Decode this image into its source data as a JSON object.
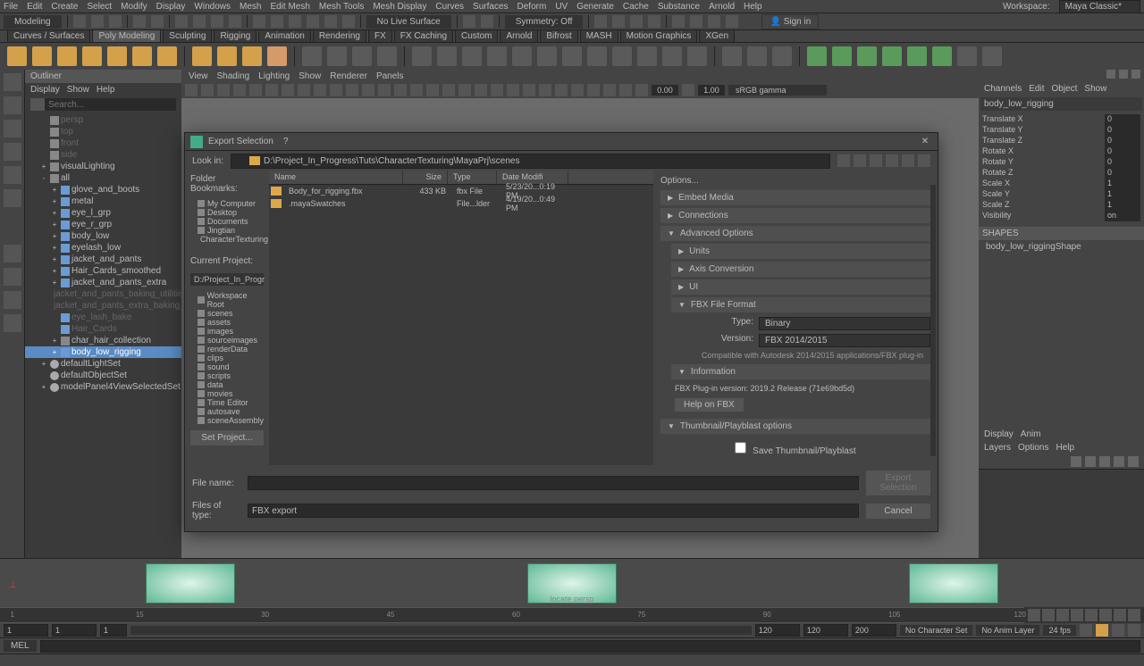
{
  "menubar": [
    "File",
    "Edit",
    "Create",
    "Select",
    "Modify",
    "Display",
    "Windows",
    "Mesh",
    "Edit Mesh",
    "Mesh Tools",
    "Mesh Display",
    "Curves",
    "Surfaces",
    "Deform",
    "UV",
    "Generate",
    "Cache",
    "Substance",
    "Arnold",
    "Help"
  ],
  "workspaceLabel": "Workspace:",
  "workspace": "Maya Classic*",
  "modelingDD": "Modeling",
  "liveSurface": "No Live Surface",
  "symmetry": "Symmetry: Off",
  "signIn": "Sign in",
  "tabs": [
    "Curves / Surfaces",
    "Poly Modeling",
    "Sculpting",
    "Rigging",
    "Animation",
    "Rendering",
    "FX",
    "FX Caching",
    "Custom",
    "Arnold",
    "Bifrost",
    "MASH",
    "Motion Graphics",
    "XGen"
  ],
  "activeTab": 1,
  "outliner": {
    "title": "Outliner",
    "menu": [
      "Display",
      "Show",
      "Help"
    ],
    "searchPH": "Search...",
    "tree": [
      {
        "ind": 1,
        "tog": "",
        "type": "grp",
        "name": "persp",
        "dim": true
      },
      {
        "ind": 1,
        "tog": "",
        "type": "grp",
        "name": "top",
        "dim": true
      },
      {
        "ind": 1,
        "tog": "",
        "type": "grp",
        "name": "front",
        "dim": true
      },
      {
        "ind": 1,
        "tog": "",
        "type": "grp",
        "name": "side",
        "dim": true
      },
      {
        "ind": 1,
        "tog": "+",
        "type": "grp",
        "name": "visualLighting"
      },
      {
        "ind": 1,
        "tog": "-",
        "type": "grp",
        "name": "all"
      },
      {
        "ind": 2,
        "tog": "+",
        "type": "mesh",
        "name": "glove_and_boots"
      },
      {
        "ind": 2,
        "tog": "+",
        "type": "mesh",
        "name": "metal"
      },
      {
        "ind": 2,
        "tog": "+",
        "type": "mesh",
        "name": "eye_l_grp"
      },
      {
        "ind": 2,
        "tog": "+",
        "type": "mesh",
        "name": "eye_r_grp"
      },
      {
        "ind": 2,
        "tog": "+",
        "type": "mesh",
        "name": "body_low"
      },
      {
        "ind": 2,
        "tog": "+",
        "type": "mesh",
        "name": "eyelash_low"
      },
      {
        "ind": 2,
        "tog": "+",
        "type": "mesh",
        "name": "jacket_and_pants"
      },
      {
        "ind": 2,
        "tog": "+",
        "type": "mesh",
        "name": "Hair_Cards_smoothed"
      },
      {
        "ind": 2,
        "tog": "+",
        "type": "mesh",
        "name": "jacket_and_pants_extra"
      },
      {
        "ind": 2,
        "tog": "",
        "type": "mesh",
        "name": "jacket_and_pants_baking_utilities",
        "dim": true
      },
      {
        "ind": 2,
        "tog": "",
        "type": "mesh",
        "name": "jacket_and_pants_extra_baking_utili",
        "dim": true
      },
      {
        "ind": 2,
        "tog": "",
        "type": "mesh",
        "name": "eye_lash_bake",
        "dim": true
      },
      {
        "ind": 2,
        "tog": "",
        "type": "mesh",
        "name": "Hair_Cards",
        "dim": true
      },
      {
        "ind": 2,
        "tog": "+",
        "type": "grp",
        "name": "char_hair_collection"
      },
      {
        "ind": 2,
        "tog": "+",
        "type": "mesh",
        "name": "body_low_rigging",
        "sel": true
      },
      {
        "ind": 1,
        "tog": "+",
        "type": "set",
        "name": "defaultLightSet"
      },
      {
        "ind": 1,
        "tog": "",
        "type": "set",
        "name": "defaultObjectSet"
      },
      {
        "ind": 1,
        "tog": "+",
        "type": "set",
        "name": "modelPanel4ViewSelectedSet"
      }
    ]
  },
  "viewport": {
    "menu": [
      "View",
      "Shading",
      "Lighting",
      "Show",
      "Renderer",
      "Panels"
    ],
    "num1": "0.00",
    "num2": "1.00",
    "gamma": "sRGB gamma",
    "perLabel": "locate   persp"
  },
  "channel": {
    "menu": [
      "Channels",
      "Edit",
      "Object",
      "Show"
    ],
    "objName": "body_low_rigging",
    "attrs": [
      {
        "n": "Translate X",
        "v": "0"
      },
      {
        "n": "Translate Y",
        "v": "0"
      },
      {
        "n": "Translate Z",
        "v": "0"
      },
      {
        "n": "Rotate X",
        "v": "0"
      },
      {
        "n": "Rotate Y",
        "v": "0"
      },
      {
        "n": "Rotate Z",
        "v": "0"
      },
      {
        "n": "Scale X",
        "v": "1"
      },
      {
        "n": "Scale Y",
        "v": "1"
      },
      {
        "n": "Scale Z",
        "v": "1"
      },
      {
        "n": "Visibility",
        "v": "on"
      }
    ],
    "shapesHdr": "SHAPES",
    "shapeName": "body_low_riggingShape"
  },
  "layers": {
    "tabs": [
      "Display",
      "Anim"
    ],
    "menu": [
      "Layers",
      "Options",
      "Help"
    ]
  },
  "timeline": {
    "ticks": [
      "1",
      "15",
      "30",
      "45",
      "60",
      "75",
      "90",
      "105",
      "120"
    ],
    "rangeStart": "1",
    "playStart": "1",
    "curFrame": "1",
    "playEnd": "120",
    "rangeEnd": "120",
    "rangeEnd2": "200",
    "charSet": "No Character Set",
    "animLayer": "No Anim Layer",
    "fps": "24 fps"
  },
  "mel": "MEL",
  "dialog": {
    "title": "Export Selection",
    "lookInLabel": "Look in:",
    "path": "D:\\Project_In_Progress\\Tuts\\CharacterTexturing\\MayaPrj\\scenes",
    "bookmarksHdr": "Folder Bookmarks:",
    "bookmarks": [
      "My Computer",
      "Desktop",
      "Documents",
      "Jingtian",
      "CharacterTexturing"
    ],
    "curProjHdr": "Current Project:",
    "curProj": "D:/Project_In_Progr",
    "wsItems": [
      "Workspace Root",
      "scenes",
      "assets",
      "images",
      "sourceimages",
      "renderData",
      "clips",
      "sound",
      "scripts",
      "data",
      "movies",
      "Time Editor",
      "autosave",
      "sceneAssembly"
    ],
    "setProject": "Set Project...",
    "cols": {
      "name": "Name",
      "size": "Size",
      "type": "Type",
      "date": "Date Modifi"
    },
    "files": [
      {
        "name": "Body_for_rigging.fbx",
        "size": "433 KB",
        "type": "fbx File",
        "date": "5/23/20...0:19 PM"
      },
      {
        "name": ".mayaSwatches",
        "size": "",
        "type": "File...lder",
        "date": "4/19/20...0:49 PM"
      }
    ],
    "optionsHdr": "Options...",
    "sections": {
      "embedMedia": "Embed Media",
      "connections": "Connections",
      "advanced": "Advanced Options",
      "units": "Units",
      "axis": "Axis Conversion",
      "ui": "UI",
      "fbxFmt": "FBX File Format",
      "typeLabel": "Type:",
      "typeVal": "Binary",
      "verLabel": "Version:",
      "verVal": "FBX 2014/2015",
      "compat": "Compatible with Autodesk 2014/2015 applications/FBX plug-in",
      "info": "Information",
      "plugin": "FBX Plug-in version:  2019.2 Release (71e69bd5d)",
      "helpFbx": "Help on FBX",
      "thumb": "Thumbnail/Playblast options",
      "saveThumb": "Save Thumbnail/Playblast"
    },
    "fileNameLabel": "File name:",
    "fileName": "",
    "typeLabel": "Files of type:",
    "typeVal": "FBX export",
    "exportBtn": "Export Selection",
    "cancelBtn": "Cancel"
  }
}
